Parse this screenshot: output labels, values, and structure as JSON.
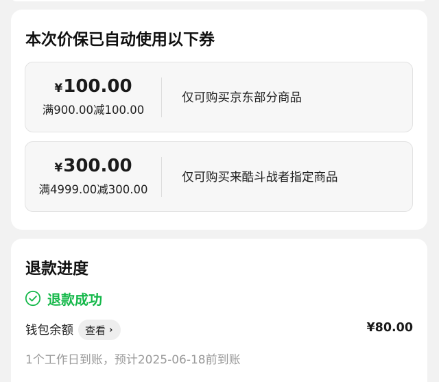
{
  "coupons_section": {
    "title": "本次价保已自动使用以下券",
    "coupons": [
      {
        "currency": "¥",
        "amount": "100.00",
        "condition": "满900.00减100.00",
        "scope": "仅可购买京东部分商品"
      },
      {
        "currency": "¥",
        "amount": "300.00",
        "condition": "满4999.00减300.00",
        "scope": "仅可购买来酷斗战者指定商品"
      }
    ]
  },
  "refund_section": {
    "title": "退款进度",
    "status": "退款成功",
    "status_color": "#15b84a",
    "status_icon": "check-circle-icon",
    "wallet_label": "钱包余额",
    "view_button_label": "查看",
    "view_button_icon": "chevron-right-icon",
    "amount": "¥80.00",
    "eta_note": "1个工作日到账，预计2025-06-18前到账"
  }
}
